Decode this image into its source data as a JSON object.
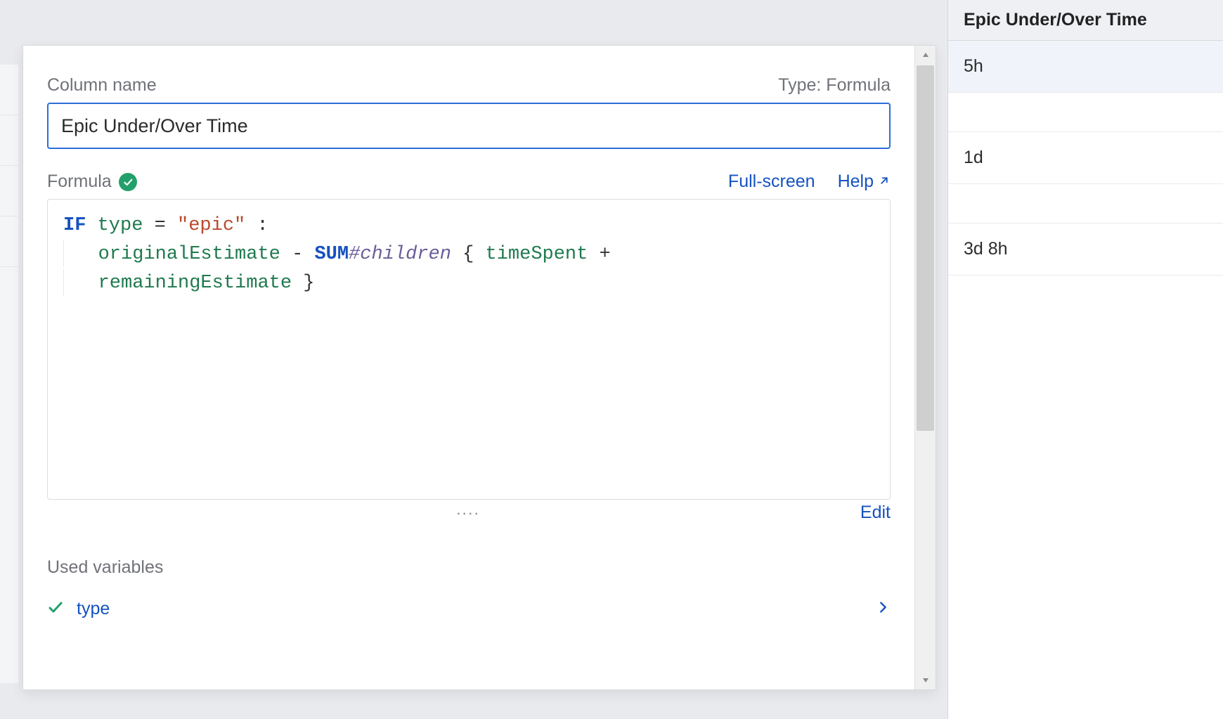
{
  "preview": {
    "header": "Epic Under/Over Time",
    "rows": [
      "5h",
      "",
      "1d",
      "",
      "3d 8h"
    ]
  },
  "dialog": {
    "column_name_label": "Column name",
    "type_label": "Type: Formula",
    "column_name_value": "Epic Under/Over Time",
    "formula_label": "Formula",
    "fullscreen_label": "Full-screen",
    "help_label": "Help",
    "edit_label": "Edit",
    "drag_dots": "....",
    "used_variables_label": "Used variables",
    "formula_tokens": {
      "if": "IF",
      "type": "type",
      "eq": "=",
      "epic_str": "\"epic\"",
      "colon": ":",
      "originalEstimate": "originalEstimate",
      "minus": "-",
      "sum": "SUM",
      "hash_children": "#children",
      "lbrace": "{",
      "timeSpent": "timeSpent",
      "plus": "+",
      "remainingEstimate": "remainingEstimate",
      "rbrace": "}"
    },
    "variables": [
      {
        "name": "type"
      }
    ]
  }
}
